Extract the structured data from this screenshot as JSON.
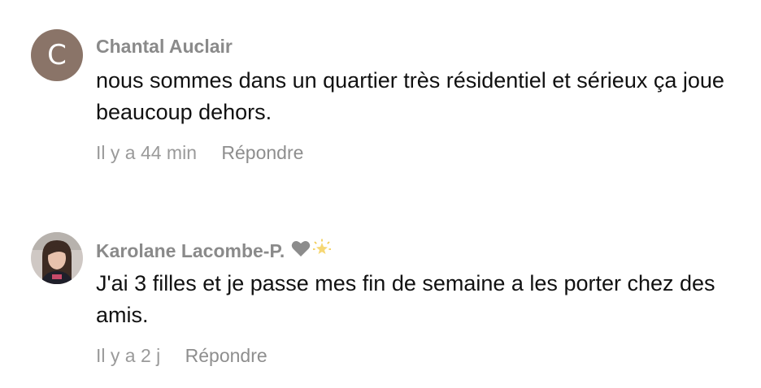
{
  "comments": [
    {
      "avatar_letter": "C",
      "author": "Chantal Auclair",
      "text": "nous sommes dans un quartier très résidentiel et sérieux ça joue beaucoup dehors.",
      "time": "Il y a 44 min",
      "reply_label": "Répondre",
      "avatar_color": "#8a7468"
    },
    {
      "avatar_icon": "profile-photo",
      "author": "Karolane Lacombe-P.",
      "badges": [
        "grey-heart-icon",
        "sparkle-star-icon"
      ],
      "text": "J'ai 3 filles et je passe mes fin de semaine a les porter chez des amis.",
      "time": "Il y a 2 j",
      "reply_label": "Répondre"
    }
  ],
  "colors": {
    "author": "#8a8a8a",
    "text": "#111111",
    "meta": "#9a9a9a"
  }
}
